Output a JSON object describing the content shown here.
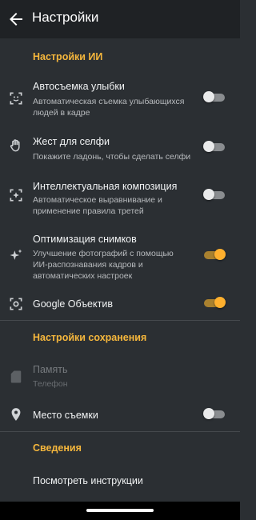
{
  "header": {
    "title": "Настройки",
    "back_icon": "arrow-back-icon"
  },
  "sections": {
    "ai": "Настройки ИИ",
    "save": "Настройки сохранения",
    "info": "Сведения"
  },
  "ai_items": [
    {
      "icon": "smile-shot-icon",
      "title": "Автосъемка улыбки",
      "line1": "Автоматическая съемка улыбающихся",
      "line2": "людей в кадре",
      "line3": "",
      "enabled": false
    },
    {
      "icon": "palm-gesture-icon",
      "title": "Жест для селфи",
      "line1": "Покажите ладонь, чтобы сделать селфи",
      "line2": "",
      "line3": "",
      "enabled": false
    },
    {
      "icon": "composition-icon",
      "title": "Интеллектуальная композиция",
      "line1": "Автоматическое выравнивание и",
      "line2": "применение правила третей",
      "line3": "",
      "enabled": false
    },
    {
      "icon": "sparkle-icon",
      "title": "Оптимизация снимков",
      "line1": "Улучшение фотографий с помощью",
      "line2": "ИИ-распознавания кадров и",
      "line3": "автоматических настроек",
      "enabled": true
    },
    {
      "icon": "google-lens-icon",
      "title": "Google Объектив",
      "line1": "",
      "line2": "",
      "line3": "",
      "enabled": true
    }
  ],
  "save_items": {
    "memory": {
      "icon": "sd-card-icon",
      "title": "Память",
      "value": "Телефон",
      "disabled": true
    },
    "location": {
      "icon": "location-pin-icon",
      "title": "Место съемки",
      "enabled": false
    }
  },
  "info_items": {
    "instructions": "Посмотреть инструкции"
  },
  "colors": {
    "accent": "#f6b73c",
    "switch_on": "#ffb02e",
    "background": "#2b2f33",
    "appbar": "#1f2225"
  }
}
